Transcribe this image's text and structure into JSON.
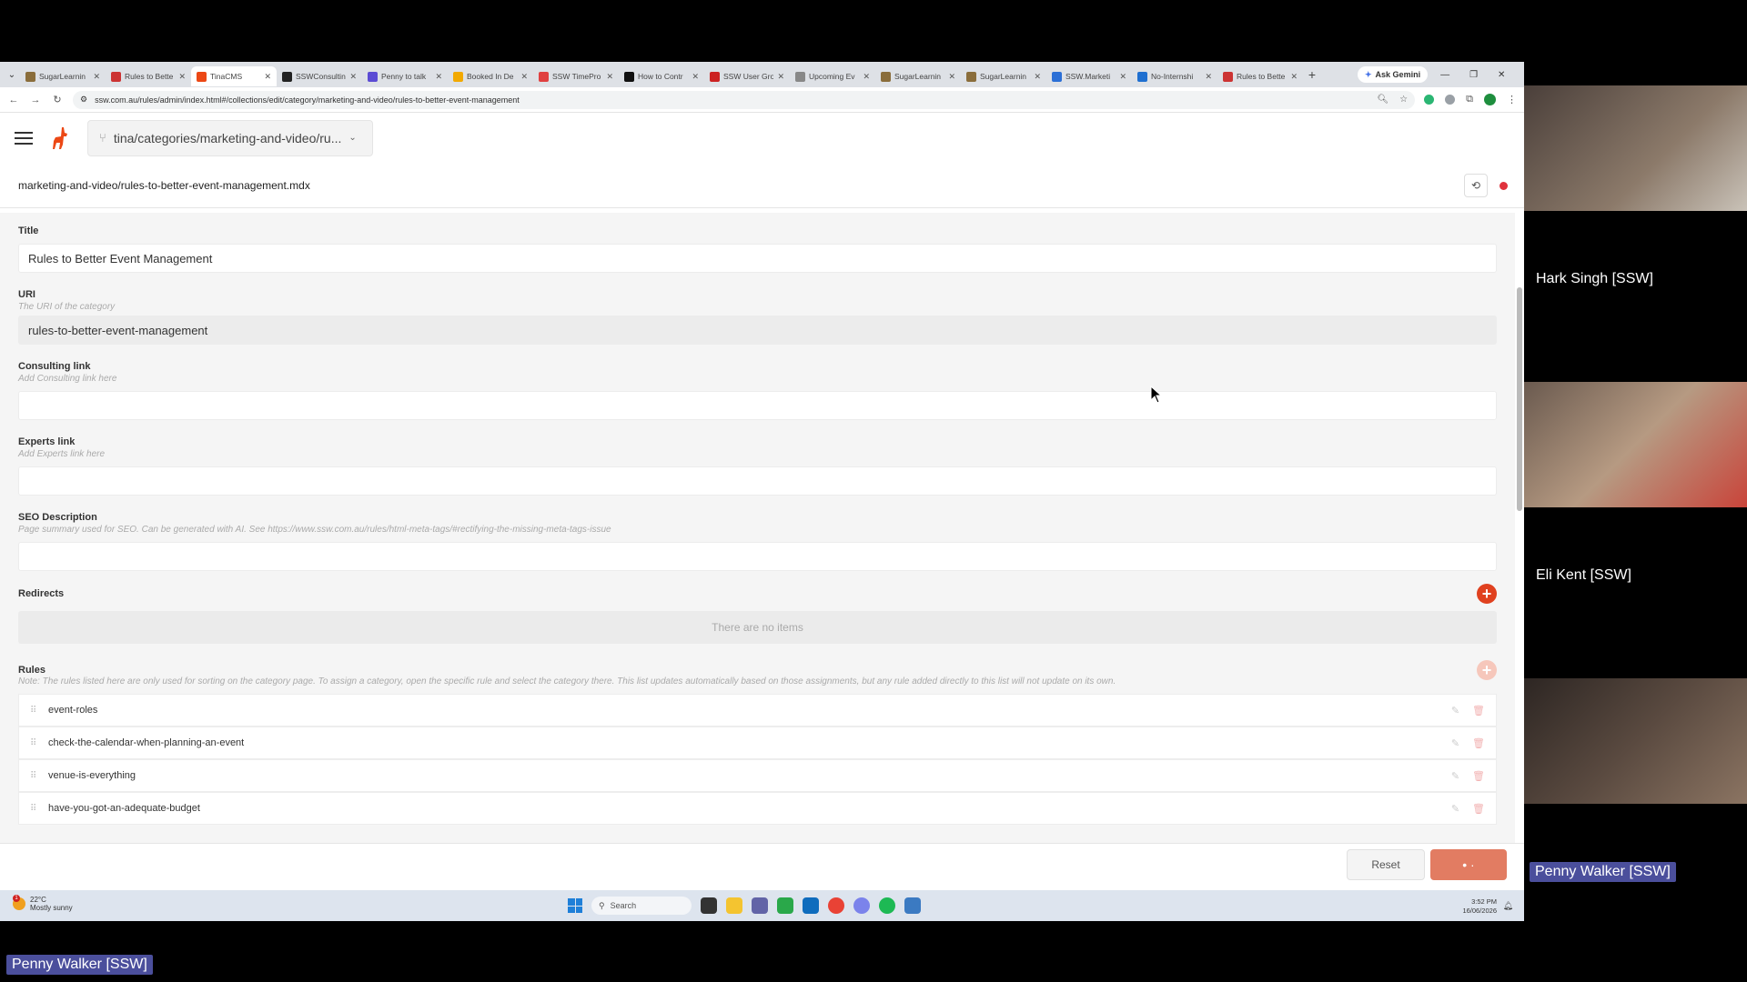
{
  "browser": {
    "tabs": [
      {
        "label": "SugarLearnin",
        "color": "#8a6d3b"
      },
      {
        "label": "Rules to Bette",
        "color": "#cc3333"
      },
      {
        "label": "TinaCMS",
        "color": "#ec4815",
        "active": true
      },
      {
        "label": "SSWConsultin",
        "color": "#222222"
      },
      {
        "label": "Penny to talk",
        "color": "#5b4bd4"
      },
      {
        "label": "Booked In De",
        "color": "#f2a900"
      },
      {
        "label": "SSW TimePro",
        "color": "#e04040"
      },
      {
        "label": "How to Contr",
        "color": "#111111"
      },
      {
        "label": "SSW User Gro",
        "color": "#cc2222"
      },
      {
        "label": "Upcoming Ev",
        "color": "#888888"
      },
      {
        "label": "SugarLearnin",
        "color": "#8a6d3b"
      },
      {
        "label": "SugarLearnin",
        "color": "#8a6d3b"
      },
      {
        "label": "SSW.Marketi",
        "color": "#2b6fd6"
      },
      {
        "label": "No-Internshi",
        "color": "#1f6fd0"
      },
      {
        "label": "Rules to Bette",
        "color": "#cc3333"
      }
    ],
    "gemini_label": "Ask Gemini",
    "url": "ssw.com.au/rules/admin/index.html#/collections/edit/category/marketing-and-video/rules-to-better-event-management"
  },
  "tina": {
    "branch": "tina/categories/marketing-and-video/ru...",
    "file_path": "marketing-and-video/rules-to-better-event-management.mdx"
  },
  "form": {
    "title": {
      "label": "Title",
      "value": "Rules to Better Event Management"
    },
    "uri": {
      "label": "URI",
      "desc": "The URI of the category",
      "value": "rules-to-better-event-management"
    },
    "consulting": {
      "label": "Consulting link",
      "desc": "Add Consulting link here",
      "value": ""
    },
    "experts": {
      "label": "Experts link",
      "desc": "Add Experts link here",
      "value": ""
    },
    "seo": {
      "label": "SEO Description",
      "desc": "Page summary used for SEO. Can be generated with AI. See https://www.ssw.com.au/rules/html-meta-tags/#rectifying-the-missing-meta-tags-issue",
      "value": ""
    },
    "redirects": {
      "label": "Redirects",
      "empty": "There are no items"
    },
    "rules": {
      "label": "Rules",
      "note": "Note: The rules listed here are only used for sorting on the category page. To assign a category, open the specific rule and select the category there. This list updates automatically based on those assignments, but any rule added directly to this list will not update on its own.",
      "items": [
        "event-roles",
        "check-the-calendar-when-planning-an-event",
        "venue-is-everything",
        "have-you-got-an-adequate-budget"
      ]
    }
  },
  "footer": {
    "reset": "Reset",
    "save": "• ·"
  },
  "taskbar": {
    "temp": "22°C",
    "weather": "Mostly sunny",
    "badge": "1",
    "search": "Search",
    "time": "3:52 PM",
    "date": "16/06/2026"
  },
  "participants": [
    {
      "name": "Hark Singh [SSW]",
      "bg": "#6b5a4f"
    },
    {
      "name": "Eli Kent [SSW]",
      "bg": "#9a7f6a"
    },
    {
      "name": "Penny Walker [SSW]",
      "bg": "#4a3a32",
      "speaking": true
    }
  ],
  "self_name": "Penny Walker [SSW]"
}
